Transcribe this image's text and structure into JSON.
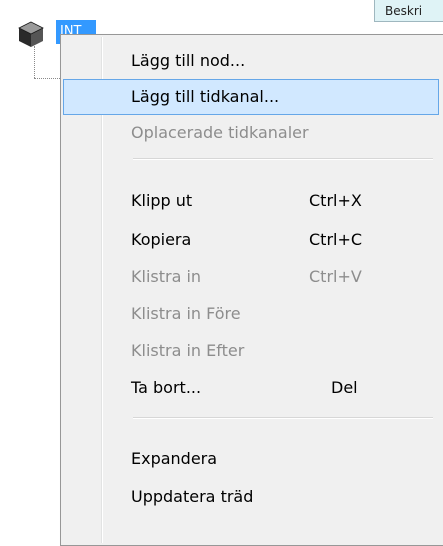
{
  "tree": {
    "node_label": "INT"
  },
  "column_header": {
    "label": "Beskri"
  },
  "menu": {
    "items": [
      {
        "label": "Lägg till nod...",
        "shortcut": "",
        "disabled": false
      },
      {
        "label": "Lägg till tidkanal...",
        "shortcut": "",
        "disabled": false,
        "highlighted": true
      },
      {
        "label": "Oplacerade tidkanaler",
        "shortcut": "",
        "disabled": true
      },
      {
        "label": "Klipp ut",
        "shortcut": "Ctrl+X",
        "disabled": false
      },
      {
        "label": "Kopiera",
        "shortcut": "Ctrl+C",
        "disabled": false
      },
      {
        "label": "Klistra in",
        "shortcut": "Ctrl+V",
        "disabled": true
      },
      {
        "label": "Klistra in Före",
        "shortcut": "",
        "disabled": true
      },
      {
        "label": "Klistra in Efter",
        "shortcut": "",
        "disabled": true
      },
      {
        "label": "Ta bort...",
        "shortcut": "Del",
        "disabled": false
      },
      {
        "label": "Expandera",
        "shortcut": "",
        "disabled": false
      },
      {
        "label": "Uppdatera träd",
        "shortcut": "",
        "disabled": false
      }
    ]
  },
  "colors": {
    "highlight_bg": "#d1e8ff",
    "highlight_border": "#66a7e8",
    "selection_bg": "#3399ff",
    "menu_bg": "#f0f0f0",
    "disabled_text": "#8d8d8d"
  },
  "icons": {
    "tree_node": "cube-icon"
  }
}
